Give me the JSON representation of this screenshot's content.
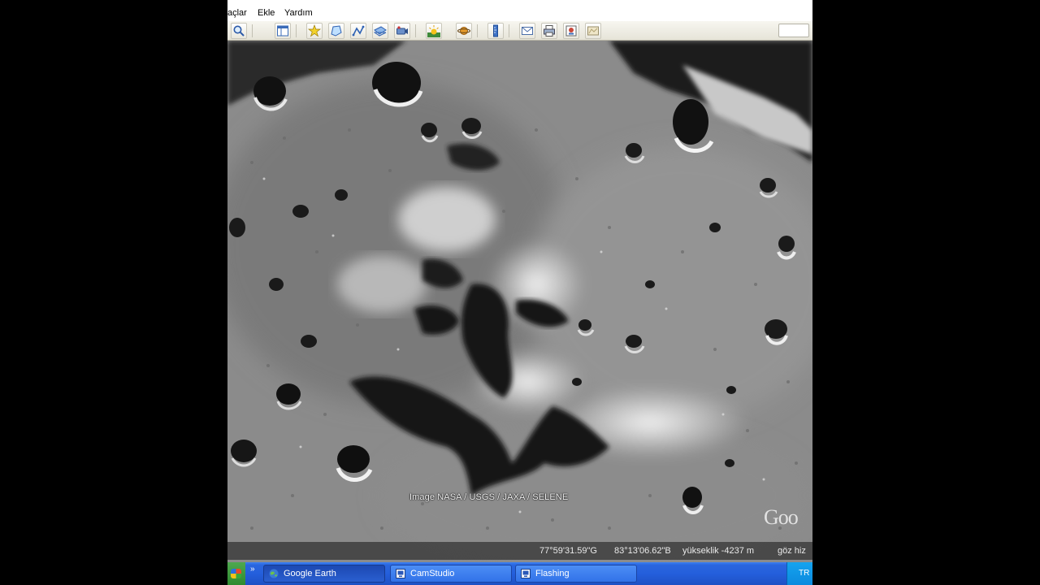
{
  "menu": {
    "items": [
      "açlar",
      "Ekle",
      "Yardım"
    ]
  },
  "toolbar": {
    "buttons": [
      {
        "icon": "search-icon"
      },
      {
        "icon": "sidebar-panel-icon"
      },
      {
        "icon": "add-placemark-icon"
      },
      {
        "icon": "add-polygon-icon"
      },
      {
        "icon": "add-path-icon"
      },
      {
        "icon": "add-image-overlay-icon"
      },
      {
        "icon": "record-tour-icon"
      },
      {
        "icon": "sunlight-icon"
      },
      {
        "icon": "planets-icon"
      },
      {
        "icon": "ruler-icon"
      },
      {
        "icon": "email-icon"
      },
      {
        "icon": "print-icon"
      },
      {
        "icon": "save-image-icon"
      },
      {
        "icon": "view-in-maps-icon"
      }
    ]
  },
  "map": {
    "attribution": "Image NASA / USGS / JAXA / SELENE",
    "logo": "Goo",
    "status": {
      "latitude": "77°59'31.59\"G",
      "longitude": "83°13'06.62\"B",
      "elevation": "yükseklik -4237 m",
      "eye": "göz hiz"
    }
  },
  "taskbar": {
    "quick_launch": "»",
    "tasks": [
      {
        "label": "Google Earth",
        "icon": "google-earth-icon",
        "active": true
      },
      {
        "label": "CamStudio",
        "icon": "camstudio-icon",
        "active": false
      },
      {
        "label": "Flashing",
        "icon": "flashing-icon",
        "active": false
      }
    ],
    "tray_lang": "TR"
  },
  "colors": {
    "taskbar_blue": "#245fdc",
    "tray_blue": "#0c8ade",
    "moon_grey": "#8f8f8f"
  }
}
